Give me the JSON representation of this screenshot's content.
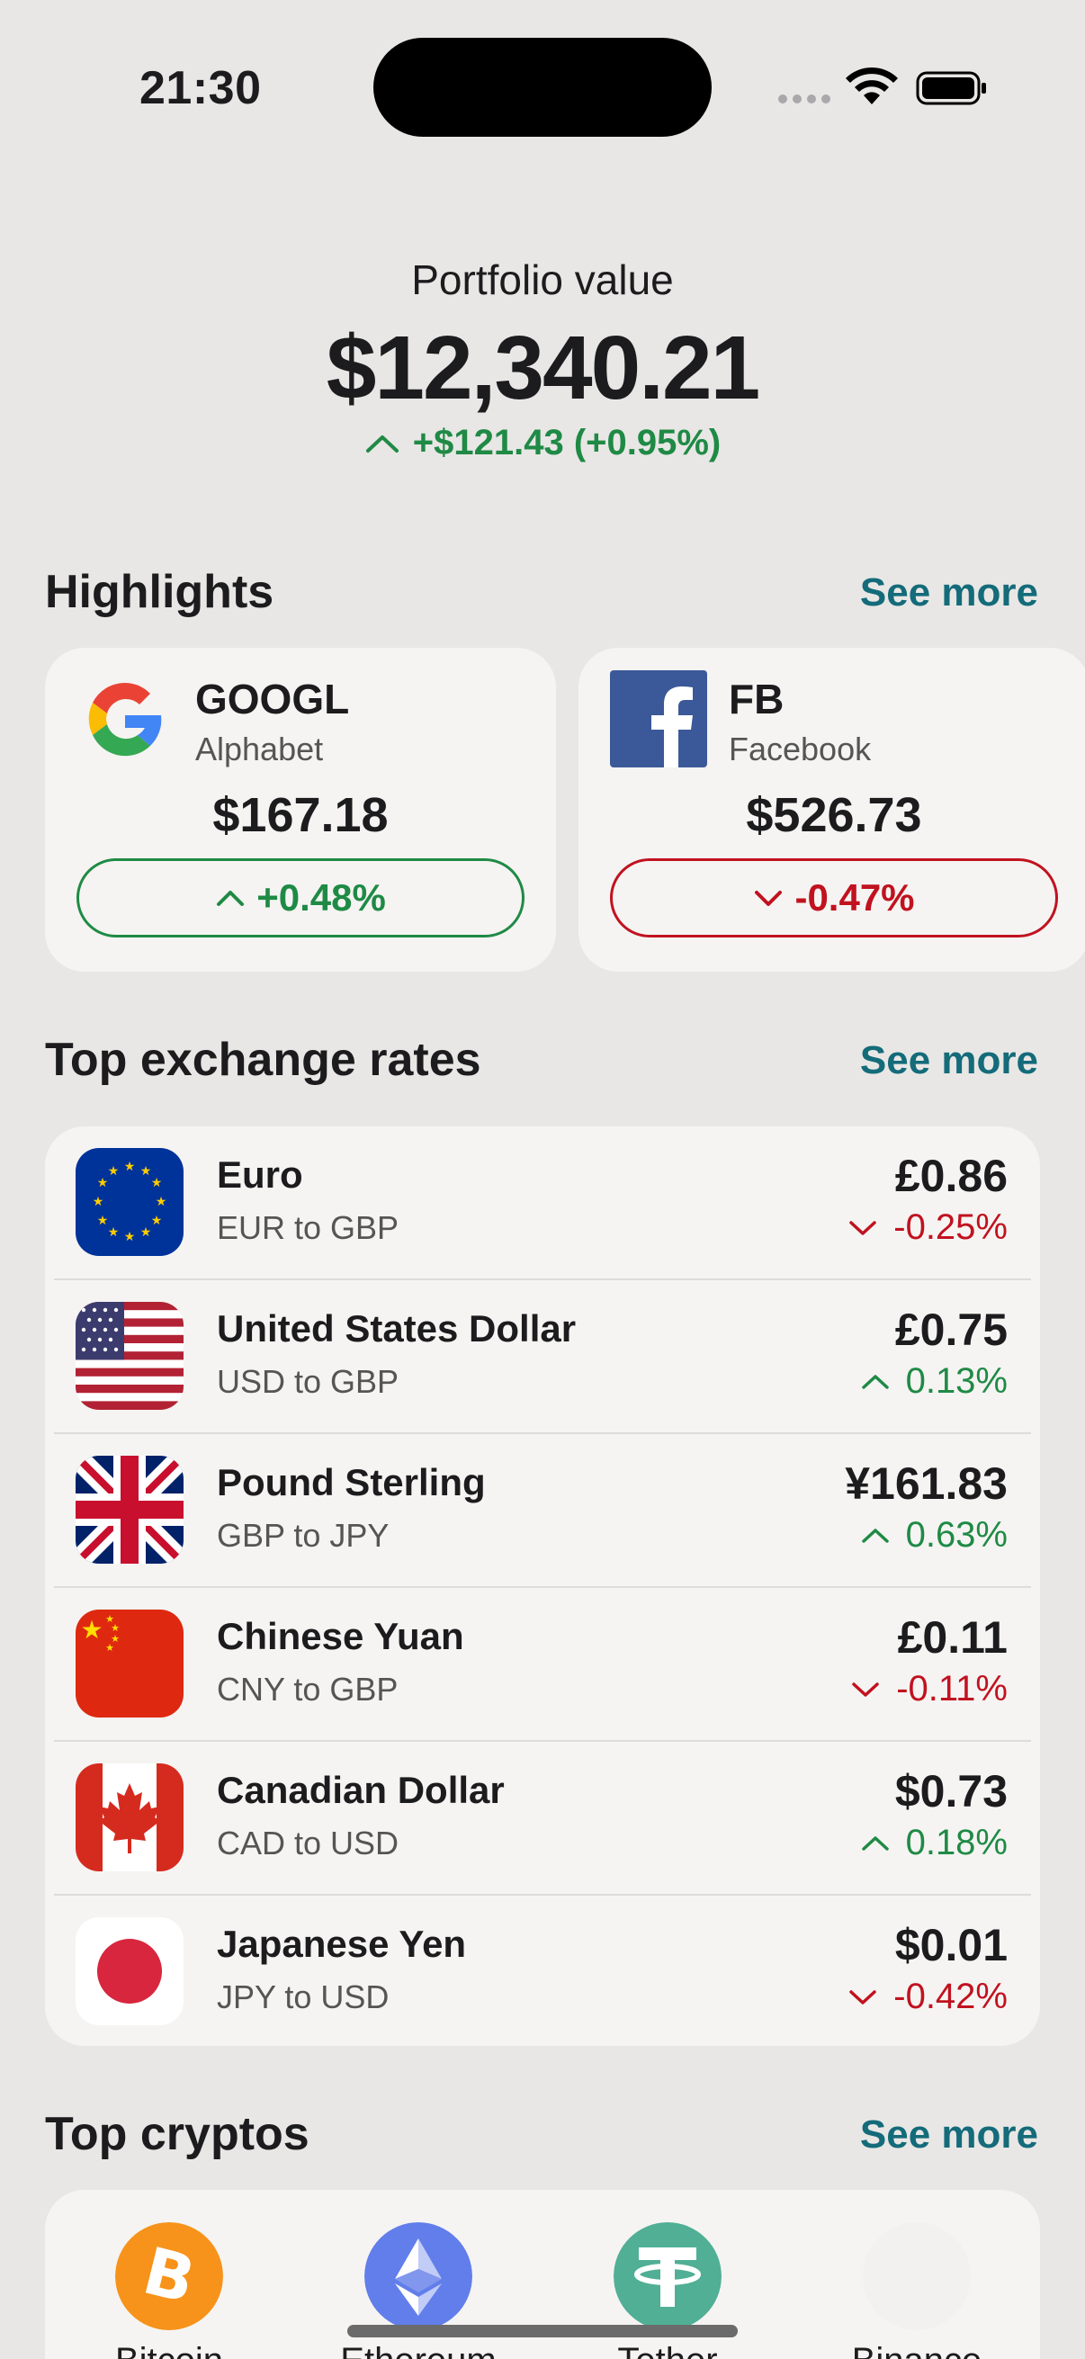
{
  "status_bar": {
    "time": "21:30"
  },
  "portfolio": {
    "label": "Portfolio value",
    "value": "$12,340.21",
    "change": "+$121.43 (+0.95%)",
    "direction": "up"
  },
  "highlights": {
    "title": "Highlights",
    "see_more": "See more",
    "cards": [
      {
        "ticker": "GOOGL",
        "name": "Alphabet",
        "price": "$167.18",
        "change": "+0.48%",
        "direction": "up",
        "icon": "google-logo-icon"
      },
      {
        "ticker": "FB",
        "name": "Facebook",
        "price": "$526.73",
        "change": "-0.47%",
        "direction": "down",
        "icon": "facebook-logo-icon"
      }
    ]
  },
  "exchange_rates": {
    "title": "Top exchange rates",
    "see_more": "See more",
    "rows": [
      {
        "name": "Euro",
        "pair": "EUR to GBP",
        "value": "£0.86",
        "change": "-0.25%",
        "direction": "down",
        "flag": "eu-flag-icon"
      },
      {
        "name": "United States Dollar",
        "pair": "USD to GBP",
        "value": "£0.75",
        "change": "0.13%",
        "direction": "up",
        "flag": "us-flag-icon"
      },
      {
        "name": "Pound Sterling",
        "pair": "GBP to JPY",
        "value": "¥161.83",
        "change": "0.63%",
        "direction": "up",
        "flag": "uk-flag-icon"
      },
      {
        "name": "Chinese Yuan",
        "pair": "CNY to GBP",
        "value": "£0.11",
        "change": "-0.11%",
        "direction": "down",
        "flag": "china-flag-icon"
      },
      {
        "name": "Canadian Dollar",
        "pair": "CAD to USD",
        "value": "$0.73",
        "change": "0.18%",
        "direction": "up",
        "flag": "canada-flag-icon"
      },
      {
        "name": "Japanese Yen",
        "pair": "JPY to USD",
        "value": "$0.01",
        "change": "-0.42%",
        "direction": "down",
        "flag": "japan-flag-icon"
      }
    ]
  },
  "cryptos": {
    "title": "Top cryptos",
    "see_more": "See more",
    "items": [
      {
        "name": "Bitcoin",
        "icon": "bitcoin-icon",
        "color": "#f7931a"
      },
      {
        "name": "Ethereum",
        "icon": "ethereum-icon",
        "color": "#627eea"
      },
      {
        "name": "Tether",
        "icon": "tether-icon",
        "color": "#50af95"
      },
      {
        "name": "Binance",
        "icon": "binance-icon",
        "color": "#f2f1ef"
      }
    ]
  },
  "colors": {
    "up": "#1f8a45",
    "down": "#c1121f",
    "accent": "#146b7a",
    "background": "#e8e7e5",
    "card": "#f5f4f2"
  }
}
